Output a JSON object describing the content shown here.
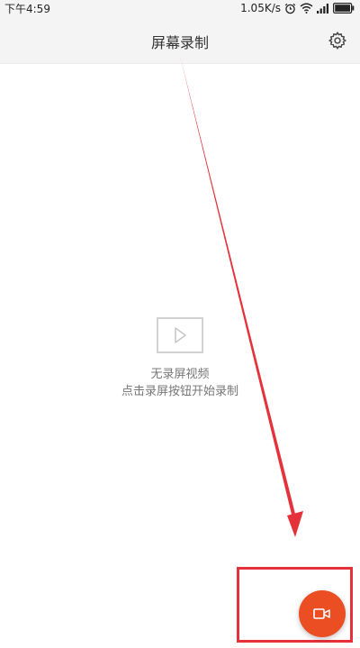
{
  "status_bar": {
    "time": "下午4:59",
    "network_speed": "1.05K/s",
    "icons": [
      "alarm-icon",
      "wifi-icon",
      "signal-icon",
      "battery-icon"
    ]
  },
  "app_bar": {
    "title": "屏幕录制",
    "settings_icon": "gear-icon"
  },
  "empty_state": {
    "icon": "video-play-icon",
    "line1": "无录屏视频",
    "line2": "点击录屏按钮开始录制"
  },
  "record_button": {
    "icon": "video-camera-icon"
  },
  "colors": {
    "accent": "#ea4e22",
    "annotation": "#e5323a",
    "bar_background": "#f4f4f4"
  }
}
